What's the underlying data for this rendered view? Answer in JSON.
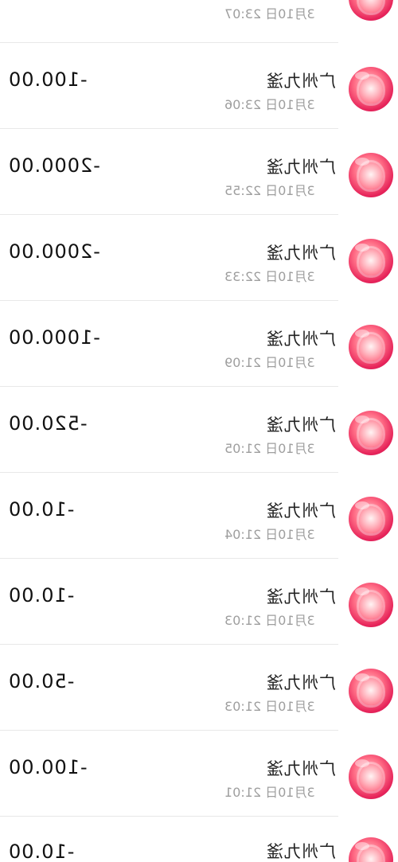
{
  "colors": {
    "amount": "#111111",
    "time": "#9e9e9e",
    "divider": "#e8e8e8",
    "avatar": "#e6245a"
  },
  "partial_top": {
    "time": "3月10日 23:07"
  },
  "transactions": [
    {
      "title": "广州九滏",
      "time": "3月10日 23:06",
      "amount": "-100.00",
      "icon": "merchant-avatar-icon"
    },
    {
      "title": "广州九滏",
      "time": "3月10日 22:55",
      "amount": "-2000.00",
      "icon": "merchant-avatar-icon"
    },
    {
      "title": "广州九滏",
      "time": "3月10日 22:33",
      "amount": "-2000.00",
      "icon": "merchant-avatar-icon"
    },
    {
      "title": "广州九滏",
      "time": "3月10日 21:09",
      "amount": "-1000.00",
      "icon": "merchant-avatar-icon"
    },
    {
      "title": "广州九滏",
      "time": "3月10日 21:05",
      "amount": "-520.00",
      "icon": "merchant-avatar-icon"
    },
    {
      "title": "广州九滏",
      "time": "3月10日 21:04",
      "amount": "-10.00",
      "icon": "merchant-avatar-icon"
    },
    {
      "title": "广州九滏",
      "time": "3月10日 21:03",
      "amount": "-10.00",
      "icon": "merchant-avatar-icon"
    },
    {
      "title": "广州九滏",
      "time": "3月10日 21:03",
      "amount": "-50.00",
      "icon": "merchant-avatar-icon"
    },
    {
      "title": "广州九滏",
      "time": "3月10日 21:01",
      "amount": "-100.00",
      "icon": "merchant-avatar-icon"
    },
    {
      "title": "广州九滏",
      "time": "",
      "amount": "-10.00",
      "icon": "merchant-avatar-icon"
    }
  ]
}
